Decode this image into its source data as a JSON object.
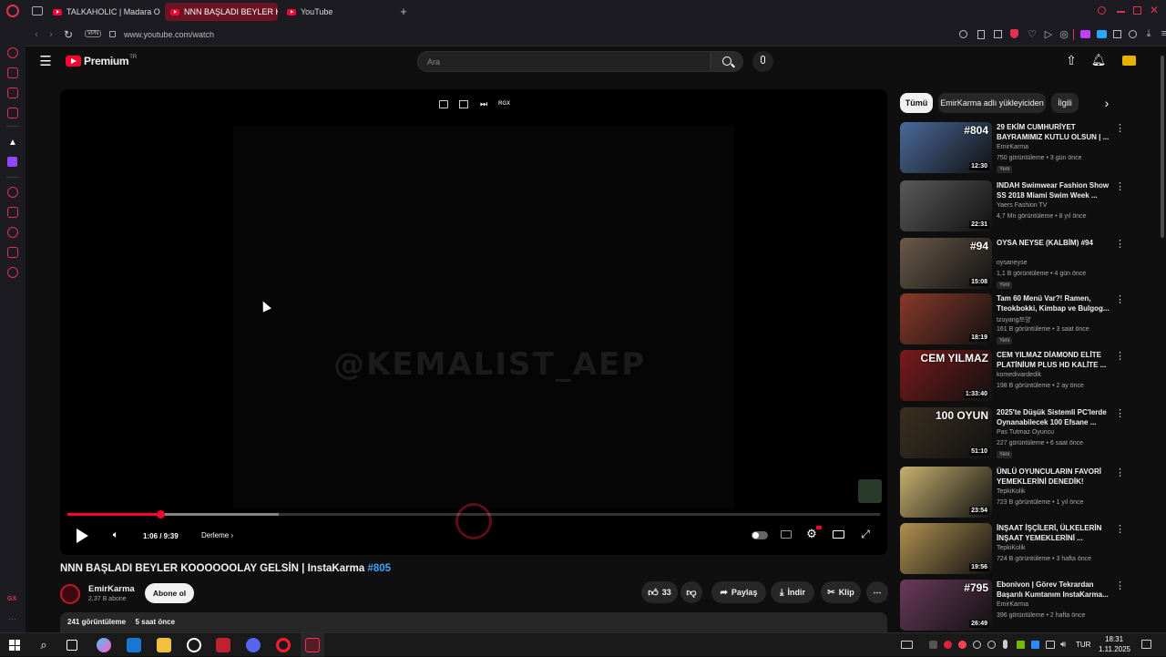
{
  "browser": {
    "tabs": [
      {
        "label": "TALKAHOLIC | Madara Ol"
      },
      {
        "label": "NNN BAŞLADI BEYLER K"
      },
      {
        "label": "YouTube"
      }
    ],
    "new_tab": "+",
    "vpn": "VPN",
    "url": "www.youtube.com/watch"
  },
  "yt": {
    "logo": "Premium",
    "logo_sup": "TR",
    "search_placeholder": "Ara"
  },
  "player": {
    "watermark": "@KEMALIST_AEP",
    "top_badge": "RGX",
    "time": "1:06 / 9:39",
    "chapter": "Derleme",
    "progress": 0.114,
    "buffered": 0.26
  },
  "video": {
    "title_main": "NNN BAŞLADI BEYLER KOOOOOOLAY GELSİN | InstaKarma ",
    "title_tag": "#805",
    "channel": "EmirKarma",
    "subs": "2,37 B abone",
    "subscribe": "Abone ol",
    "likes": "33",
    "share": "Paylaş",
    "download": "İndir",
    "clip": "Klip",
    "views": "241 görüntüleme",
    "date": "5 saat önce"
  },
  "chips": [
    "Tümü",
    "EmirKarma adlı yükleyiciden",
    "İlgili"
  ],
  "recs": [
    {
      "title": "29 EKİM CUMHURİYET BAYRAMIMIZ KUTLU OLSUN | ...",
      "channel": "EmirKarma",
      "meta": "750 görüntüleme • 3 gün önce",
      "badge": "Yeni",
      "dur": "12:30",
      "thumb_text": "#804",
      "color": "#4a6a9a"
    },
    {
      "title": "INDAH Swimwear Fashion Show SS 2018 Miami Swim Week ...",
      "channel": "Yaers Fashion TV",
      "meta": "4,7 Mn görüntüleme • 8 yıl önce",
      "badge": "",
      "dur": "22:31",
      "thumb_text": "",
      "color": "#5a5a5a"
    },
    {
      "title": "OYSA NEYSE (KALBİM) #94",
      "channel": "oysaneyse",
      "meta": "1,1 B görüntüleme • 4 gün önce",
      "badge": "Yeni",
      "dur": "15:08",
      "thumb_text": "#94",
      "color": "#6a5a4a"
    },
    {
      "title": "Tam 60 Menü Var?! Ramen, Tteokbokki, Kimbap ve Bulgog...",
      "channel": "tzuyang쯔양",
      "meta": "161 B görüntüleme • 3 saat önce",
      "badge": "Yeni",
      "dur": "18:19",
      "thumb_text": "",
      "color": "#8a3a2a"
    },
    {
      "title": "CEM YILMAZ DİAMOND ELİTE PLATİNİUM PLUS HD KALİTE ...",
      "channel": "komedivardedik",
      "meta": "198 B görüntüleme • 2 ay önce",
      "badge": "",
      "dur": "1:33:40",
      "thumb_text": "CEM YILMAZ",
      "color": "#7a1a1a"
    },
    {
      "title": "2025'te Düşük Sistemli PC'lerde Oynanabilecek 100 Efsane ...",
      "channel": "Pas Tutmaz Oyuncu",
      "meta": "227 görüntüleme • 6 saat önce",
      "badge": "Yeni",
      "dur": "51:10",
      "thumb_text": "100 OYUN",
      "color": "#3a3020"
    },
    {
      "title": "ÜNLÜ OYUNCULARIN FAVORİ YEMEKLERİNİ DENEDİK!",
      "channel": "TepkiKolik",
      "meta": "723 B görüntüleme • 1 yıl önce",
      "badge": "",
      "dur": "23:54",
      "thumb_text": "",
      "color": "#c8b070"
    },
    {
      "title": "İNŞAAT İŞÇİLERİ, ÜLKELERİN İNŞAAT YEMEKLERİNİ ...",
      "channel": "TepkiKolik",
      "meta": "724 B görüntüleme • 3 hafta önce",
      "badge": "",
      "dur": "19:56",
      "thumb_text": "",
      "color": "#b09050"
    },
    {
      "title": "Ebonivon | Görev Tekrardan Başarılı Kumtanım InstaKarma...",
      "channel": "EmirKarma",
      "meta": "396 görüntüleme • 2 hafta önce",
      "badge": "",
      "dur": "26:49",
      "thumb_text": "#795",
      "color": "#6a3a5a"
    }
  ],
  "taskbar": {
    "lang": "TUR",
    "time": "18:31",
    "date": "1.11.2025"
  },
  "colors": {
    "accent": "#ff0033",
    "opera": "#e0334f",
    "link": "#3ea6ff"
  }
}
